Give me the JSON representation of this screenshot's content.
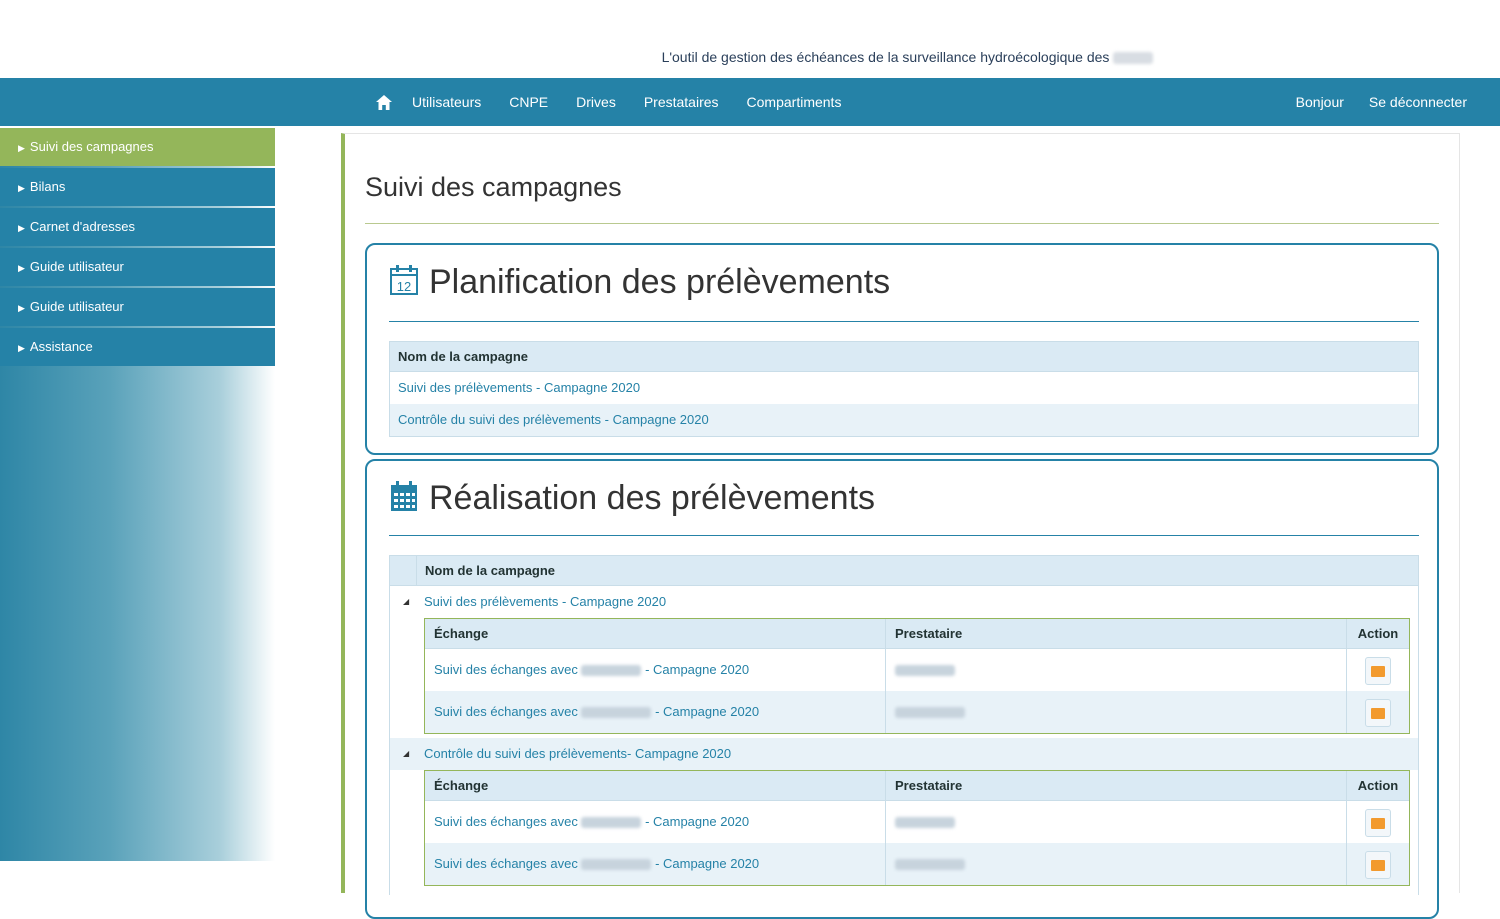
{
  "header": {
    "tagline": "L'outil de gestion des échéances de la surveillance hydroécologique des"
  },
  "nav": {
    "items": [
      "Utilisateurs",
      "CNPE",
      "Drives",
      "Prestataires",
      "Compartiments"
    ],
    "right": [
      "Bonjour",
      "Se déconnecter"
    ]
  },
  "sidebar": {
    "items": [
      {
        "label": "Suivi des campagnes"
      },
      {
        "label": "Bilans"
      },
      {
        "label": "Carnet d'adresses"
      },
      {
        "label": "Guide utilisateur"
      },
      {
        "label": "Guide utilisateur"
      },
      {
        "label": "Assistance"
      }
    ]
  },
  "main": {
    "title": "Suivi des campagnes",
    "planification": {
      "title": "Planification des prélèvements",
      "column": "Nom de la campagne",
      "rows": [
        "Suivi des prélèvements - Campagne 2020",
        "Contrôle du suivi des prélèvements - Campagne 2020"
      ]
    },
    "realisation": {
      "title": "Réalisation des prélèvements",
      "column": "Nom de la campagne",
      "sub_headers": {
        "exchange": "Échange",
        "provider": "Prestataire",
        "action": "Action"
      },
      "groups": [
        {
          "name": "Suivi des prélèvements - Campagne 2020",
          "rows": [
            {
              "prefix": "Suivi des échanges avec",
              "suffix": "- Campagne 2020"
            },
            {
              "prefix": "Suivi des échanges avec",
              "suffix": "- Campagne 2020"
            }
          ]
        },
        {
          "name": "Contrôle du suivi des prélèvements- Campagne 2020",
          "rows": [
            {
              "prefix": "Suivi des échanges avec",
              "suffix": "- Campagne 2020"
            },
            {
              "prefix": "Suivi des échanges avec",
              "suffix": "- Campagne 2020"
            }
          ]
        }
      ]
    }
  },
  "colors": {
    "primary": "#2582a7",
    "accent": "#94b65a",
    "action": "#f29a2e"
  },
  "icons": {
    "home": "home-icon",
    "calendar_outline": "calendar-12-icon",
    "calendar_filled": "calendar-icon",
    "mail": "envelope-icon"
  }
}
